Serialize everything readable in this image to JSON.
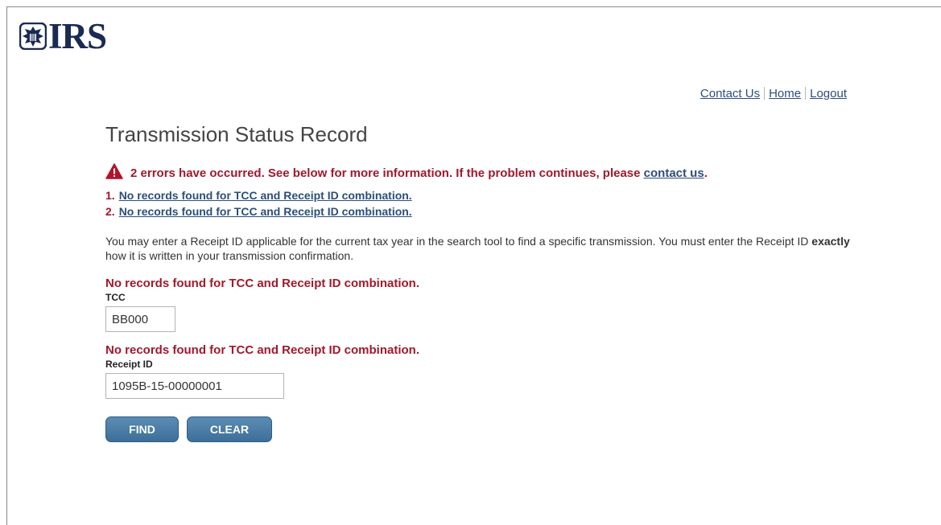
{
  "header": {
    "logo_text": "IRS",
    "logo_icon": "eagle-seal-icon"
  },
  "top_links": [
    {
      "label": "Contact Us"
    },
    {
      "label": "Home"
    },
    {
      "label": "Logout"
    }
  ],
  "page_title": "Transmission Status Record",
  "error_summary": {
    "icon": "warning-icon",
    "text": "2 errors have occurred. See below for more information. If the problem continues, please ",
    "link_label": "contact us",
    "suffix": "."
  },
  "errors": [
    {
      "number": "1.",
      "message": "No records found for TCC and Receipt ID combination."
    },
    {
      "number": "2.",
      "message": "No records found for TCC and Receipt ID combination."
    }
  ],
  "instructions": {
    "part1": "You may enter a Receipt ID applicable for the current tax year in the search tool to find a specific transmission. You must enter the Receipt ID ",
    "emphasis": "exactly",
    "part2": " how it is written in your transmission confirmation."
  },
  "form": {
    "tcc": {
      "error": "No records found for TCC and Receipt ID combination.",
      "label": "TCC",
      "value": "BB000"
    },
    "receipt_id": {
      "error": "No records found for TCC and Receipt ID combination.",
      "label": "Receipt ID",
      "value": "1095B-15-00000001"
    }
  },
  "buttons": {
    "find": "FIND",
    "clear": "CLEAR"
  },
  "colors": {
    "error_red": "#a0192c",
    "link_blue": "#2c4e7a",
    "button_blue": "#4a7ca6",
    "logo_navy": "#1b2a52"
  }
}
